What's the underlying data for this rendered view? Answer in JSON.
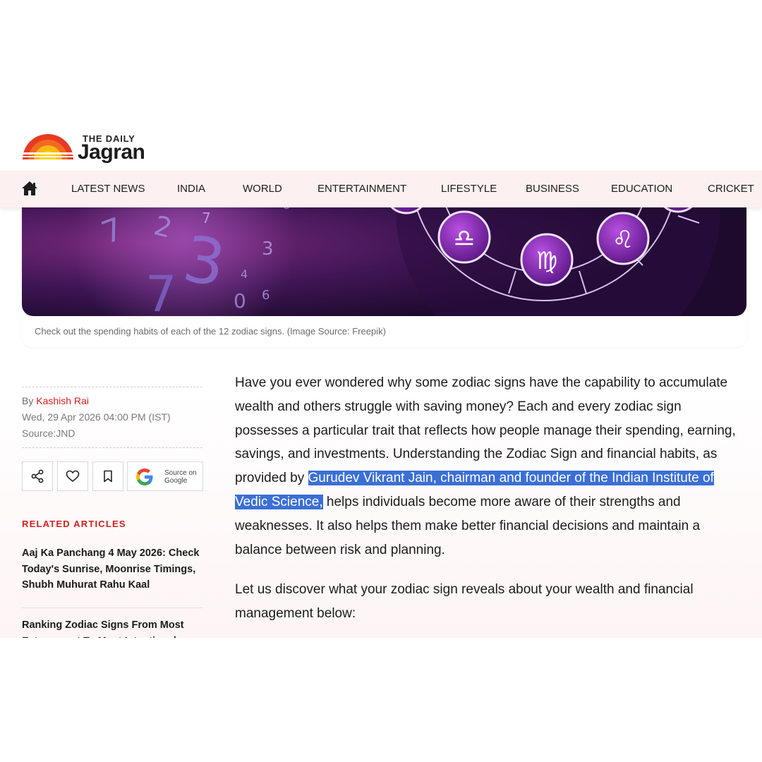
{
  "brand": {
    "small": "THE DAILY",
    "name": "Jagran"
  },
  "nav": {
    "home_icon": "home-icon",
    "items": [
      {
        "label": "LATEST NEWS"
      },
      {
        "label": "INDIA"
      },
      {
        "label": "WORLD"
      },
      {
        "label": "ENTERTAINMENT"
      },
      {
        "label": "LIFESTYLE"
      },
      {
        "label": "BUSINESS"
      },
      {
        "label": "EDUCATION"
      },
      {
        "label": "CRICKET"
      }
    ]
  },
  "hero": {
    "caption": "Check out the spending habits of each of the 12 zodiac signs. (Image Source: Freepik)"
  },
  "meta": {
    "by_prefix": "By",
    "author": "Kashish Rai",
    "date": "Wed, 29 Apr 2026 04:00 PM (IST)",
    "source": "Source:JND"
  },
  "actions": {
    "share_icon": "share-icon",
    "like_icon": "heart-icon",
    "bookmark_icon": "bookmark-icon",
    "google_line1": "Source on",
    "google_line2": "Google"
  },
  "related": {
    "heading": "RELATED ARTICLES",
    "items": [
      {
        "title": "Aaj Ka Panchang 4 May 2026: Check Today's Sunrise, Moonrise Timings, Shubh Muhurat Rahu Kaal"
      },
      {
        "title": "Ranking Zodiac Signs From Most Extravagant To Most Intentional Spenders"
      }
    ]
  },
  "article": {
    "p1_before": "Have you ever wondered why some zodiac signs have the capability to accumulate wealth and others struggle with saving money? Each and every zodiac sign possesses a particular trait that reflects how people manage their spending, earning, savings, and investments. Understanding the Zodiac Sign and financial habits, as provided by",
    "p1_highlight": "Gurudev Vikrant Jain, chairman and founder of the Indian Institute of Vedic Science,",
    "p1_after": "helps individuals become more aware of their strengths and weaknesses. It also helps them make better financial decisions and maintain a balance between risk and planning.",
    "p2": "Let us discover what your zodiac sign reveals about your wealth and financial management below:"
  },
  "colors": {
    "accent_red": "#d3201f",
    "nav_bg": "#fcf0f1",
    "selection": "#3b6fd6"
  }
}
